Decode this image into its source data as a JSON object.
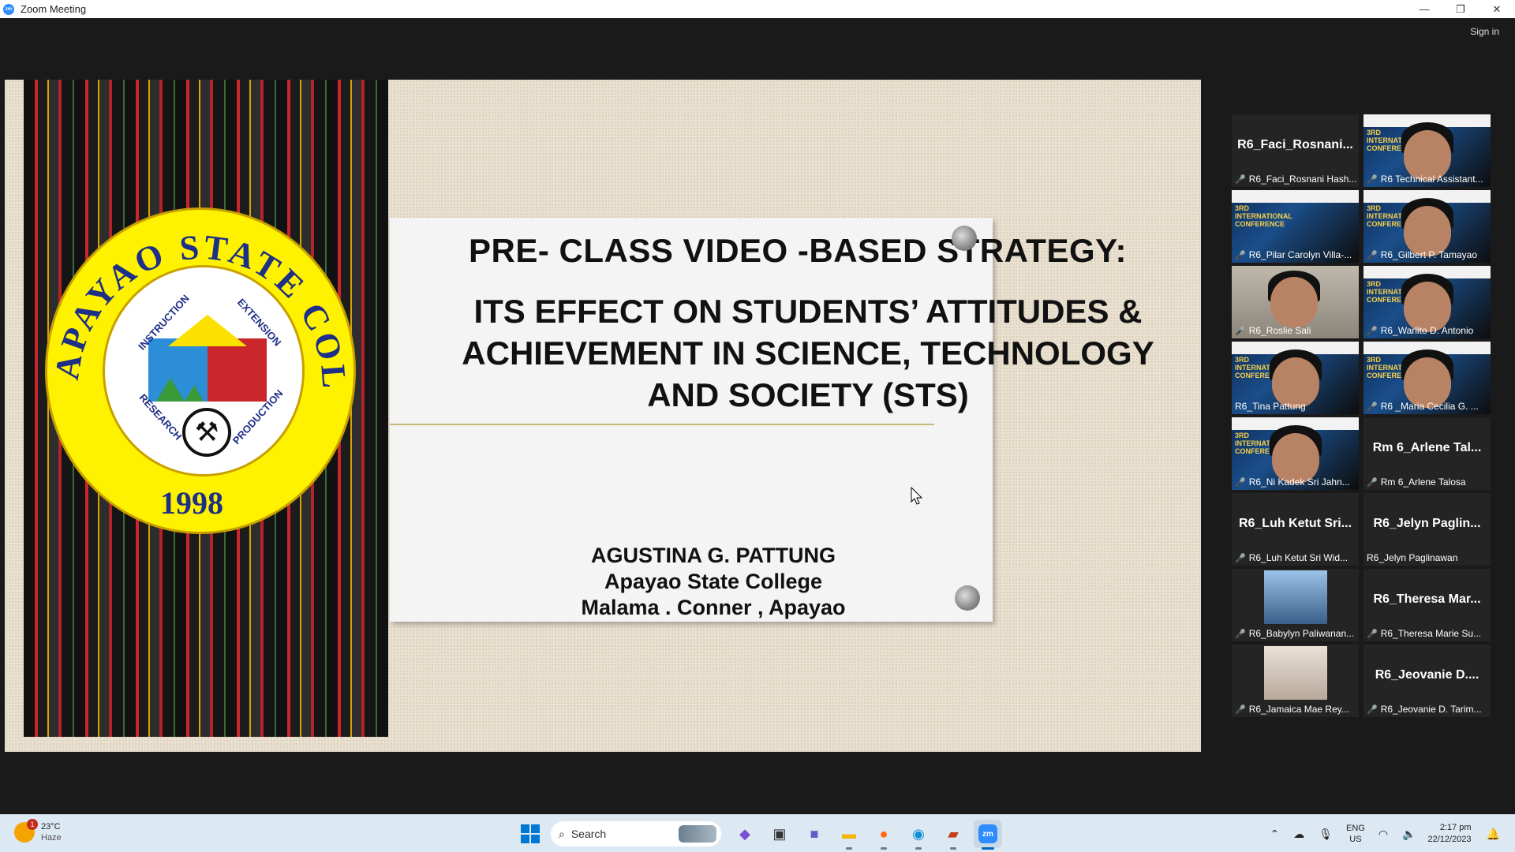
{
  "window": {
    "title": "Zoom Meeting",
    "app_icon": "zm",
    "controls": {
      "minimize": "—",
      "restore": "❐",
      "close": "✕"
    }
  },
  "meeting": {
    "signin_label": "Sign in"
  },
  "slide": {
    "seal": {
      "name_top": "APAYAO STATE COLLEGE",
      "year": "1998",
      "labels": [
        "INSTRUCTION",
        "EXTENSION",
        "RESEARCH",
        "PRODUCTION"
      ]
    },
    "title": "PRE- CLASS VIDEO -BASED STRATEGY:",
    "subtitle_lines": [
      "ITS EFFECT  ON STUDENTS’ ATTITUDES &",
      "ACHIEVEMENT IN SCIENCE, TECHNOLOGY",
      "AND SOCIETY (STS)"
    ],
    "author_lines": [
      "AGUSTINA G. PATTUNG",
      "Apayao State College",
      "Malama . Conner , Apayao"
    ]
  },
  "participants": [
    {
      "big": "R6_Faci_Rosnani...",
      "label": "R6_Faci_Rosnani Hash...",
      "muted": true,
      "video": "none"
    },
    {
      "big": "",
      "label": "R6 Technical Assistant...",
      "muted": true,
      "video": "person-conf"
    },
    {
      "big": "",
      "label": "R6_Pilar Carolyn Villa-...",
      "muted": true,
      "video": "conf"
    },
    {
      "big": "",
      "label": "R6_Gilbert P. Tamayao",
      "muted": true,
      "video": "person-conf"
    },
    {
      "big": "",
      "label": "R6_Roslie Sali",
      "muted": true,
      "video": "room"
    },
    {
      "big": "",
      "label": "R6_Warlito D. Antonio",
      "muted": true,
      "video": "person-conf"
    },
    {
      "big": "",
      "label": "R6_Tina Pattung",
      "muted": false,
      "video": "person-conf",
      "active": true
    },
    {
      "big": "",
      "label": "R6 _Maria Cecilia G. ...",
      "muted": true,
      "video": "person-conf"
    },
    {
      "big": "",
      "label": "R6_Ni Kadek Sri Jahn...",
      "muted": true,
      "video": "person-conf"
    },
    {
      "big": "Rm 6_Arlene Tal...",
      "label": "Rm 6_Arlene Talosa",
      "muted": true,
      "video": "none"
    },
    {
      "big": "R6_Luh Ketut Sri...",
      "label": "R6_Luh Ketut Sri Wid...",
      "muted": true,
      "video": "none"
    },
    {
      "big": "R6_Jelyn  Paglin...",
      "label": "R6_Jelyn Paglinawan",
      "muted": false,
      "video": "none"
    },
    {
      "big": "",
      "label": "R6_Babylyn Paliwanan...",
      "muted": true,
      "video": "photo"
    },
    {
      "big": "R6_Theresa  Mar...",
      "label": "R6_Theresa Marie Su...",
      "muted": true,
      "video": "none"
    },
    {
      "big": "",
      "label": "R6_Jamaica Mae Rey...",
      "muted": true,
      "video": "photo2"
    },
    {
      "big": "R6_Jeovanie  D....",
      "label": "R6_Jeovanie D. Tarim...",
      "muted": true,
      "video": "none"
    }
  ],
  "video_text": {
    "conf": "3RD\nINTERNATIONAL\nCONFERENCE"
  },
  "taskbar": {
    "weather": {
      "temp": "23°C",
      "condition": "Haze",
      "badge": "1"
    },
    "search_placeholder": "Search",
    "tray": {
      "lang_top": "ENG",
      "lang_bottom": "US",
      "time": "2:17 pm",
      "date": "22/12/2023"
    }
  },
  "colors": {
    "zoom_blue": "#2d8cff",
    "active_speaker": "#c6e54a",
    "muted_red": "#e0322b",
    "taskbar": "#dce8f2"
  }
}
